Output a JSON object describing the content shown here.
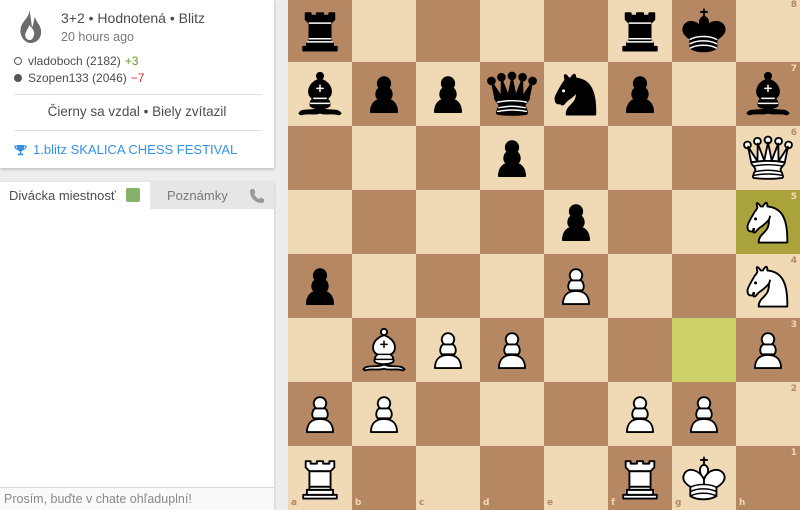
{
  "game": {
    "setup": "3+2 • Hodnotená • Blitz",
    "time_ago": "20 hours ago",
    "players": [
      {
        "name": "vladoboch (2182)",
        "diff": "+3",
        "color": "white"
      },
      {
        "name": "Szopen133 (2046)",
        "diff": "−7",
        "color": "black"
      }
    ],
    "status": "Čierny sa vzdal • Biely zvítazil",
    "tournament": "1.blitz SKALICA CHESS FESTIVAL"
  },
  "chat": {
    "tab_room": "Divácka miestnosť",
    "tab_notes": "Poznámky",
    "placeholder": "Prosím, buďte v chate ohľaduplní!"
  },
  "board": {
    "files": [
      "a",
      "b",
      "c",
      "d",
      "e",
      "f",
      "g",
      "h"
    ],
    "ranks": [
      "8",
      "7",
      "6",
      "5",
      "4",
      "3",
      "2",
      "1"
    ],
    "highlighted": [
      "h5",
      "g3"
    ],
    "pieces": [
      {
        "sq": "a8",
        "color": "black",
        "type": "rook"
      },
      {
        "sq": "f8",
        "color": "black",
        "type": "rook"
      },
      {
        "sq": "g8",
        "color": "black",
        "type": "king"
      },
      {
        "sq": "a7",
        "color": "black",
        "type": "bishop"
      },
      {
        "sq": "b7",
        "color": "black",
        "type": "pawn"
      },
      {
        "sq": "c7",
        "color": "black",
        "type": "pawn"
      },
      {
        "sq": "d7",
        "color": "black",
        "type": "queen"
      },
      {
        "sq": "e7",
        "color": "black",
        "type": "knight"
      },
      {
        "sq": "f7",
        "color": "black",
        "type": "pawn"
      },
      {
        "sq": "h7",
        "color": "black",
        "type": "bishop"
      },
      {
        "sq": "d6",
        "color": "black",
        "type": "pawn"
      },
      {
        "sq": "h6",
        "color": "white",
        "type": "queen"
      },
      {
        "sq": "e5",
        "color": "black",
        "type": "pawn"
      },
      {
        "sq": "h5",
        "color": "white",
        "type": "knight"
      },
      {
        "sq": "a4",
        "color": "black",
        "type": "pawn"
      },
      {
        "sq": "e4",
        "color": "white",
        "type": "pawn"
      },
      {
        "sq": "h4",
        "color": "white",
        "type": "knight"
      },
      {
        "sq": "b3",
        "color": "white",
        "type": "bishop"
      },
      {
        "sq": "c3",
        "color": "white",
        "type": "pawn"
      },
      {
        "sq": "d3",
        "color": "white",
        "type": "pawn"
      },
      {
        "sq": "h3",
        "color": "white",
        "type": "pawn"
      },
      {
        "sq": "a2",
        "color": "white",
        "type": "pawn"
      },
      {
        "sq": "b2",
        "color": "white",
        "type": "pawn"
      },
      {
        "sq": "f2",
        "color": "white",
        "type": "pawn"
      },
      {
        "sq": "g2",
        "color": "white",
        "type": "pawn"
      },
      {
        "sq": "a1",
        "color": "white",
        "type": "rook"
      },
      {
        "sq": "f1",
        "color": "white",
        "type": "rook"
      },
      {
        "sq": "g1",
        "color": "white",
        "type": "king"
      }
    ]
  },
  "colors": {
    "light_square": "#f0d9b5",
    "dark_square": "#b58863",
    "highlight_light": "#cdd26a",
    "highlight_dark": "#aaa23a",
    "link": "#3692e7",
    "rating_up": "#629924",
    "rating_down": "#cc3333"
  }
}
